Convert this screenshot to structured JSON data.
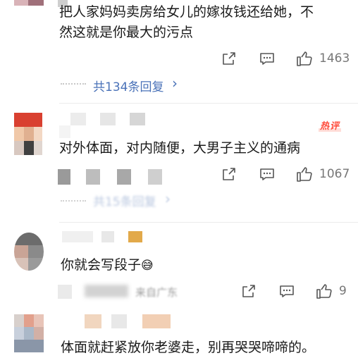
{
  "comments": [
    {
      "text_line1": "把人家妈妈卖房给女儿的嫁妆钱还给她，不",
      "text_line2": "然这就是你最大的污点",
      "like_count": "1463",
      "replies_label": "共134条回复",
      "reply_chevron": "›"
    },
    {
      "text": "对外体面，对内随便，大男子主义的通病",
      "hot_badge": "热评",
      "like_count": "1067",
      "replies_label": "共15条回复"
    },
    {
      "text": "你就会写段子",
      "emoji": "😅",
      "meta": "来自广东",
      "like_count": "9"
    },
    {
      "text": "体面就赶紧放你老婆走，别再哭哭啼啼的。"
    }
  ],
  "icons": {
    "share": "share-icon",
    "comment": "comment-icon",
    "like": "thumbs-up-icon"
  },
  "colors": {
    "link": "#4a72b8",
    "hot": "#ff4b3a",
    "muted": "#777777"
  }
}
